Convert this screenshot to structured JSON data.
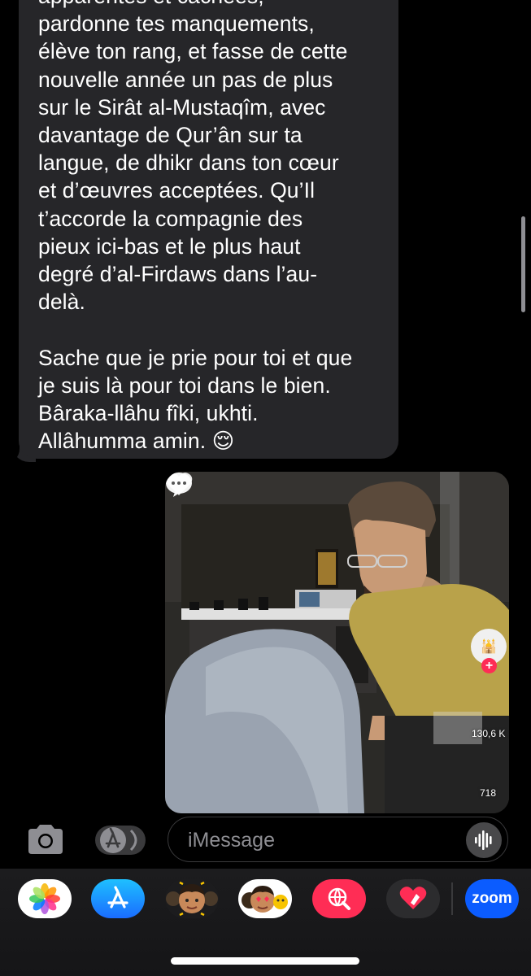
{
  "message": {
    "text": "apparentes et cachées,\npardonne tes manquements,\nélève ton rang, et fasse de cette\nnouvelle année un pas de plus\nsur le Sirât al-Mustaqîm, avec\ndavantage de Qur’ân sur ta\nlangue, de dhikr dans ton cœur\net d’œuvres acceptées. Qu’Il\nt’accorde la compagnie des\npieux ici-bas et le plus haut\ndegré d’al-Firdaws dans l’au-\ndelà.\n\nSache que je prie pour toi et que\nje suis là pour toi dans le bien.\nBâraka-llâhu fîki, ukhti.\nAllâhumma amin. 😌"
  },
  "video": {
    "likes": "130,6 K",
    "comments": "718"
  },
  "composer": {
    "placeholder": "iMessage"
  },
  "app_drawer": {
    "apps": [
      "photos-icon",
      "app-store-icon",
      "memoji-icon",
      "memoji-stickers-icon",
      "web-search-icon",
      "digital-touch-icon",
      "zoom-icon"
    ],
    "zoom_label": "zoom"
  },
  "colors": {
    "incoming_bubble": "#262629",
    "background": "#000000",
    "tiktok_red": "#fe2c55",
    "appstore_blue": "#1a8cff",
    "zoom_blue": "#0b5cff"
  }
}
